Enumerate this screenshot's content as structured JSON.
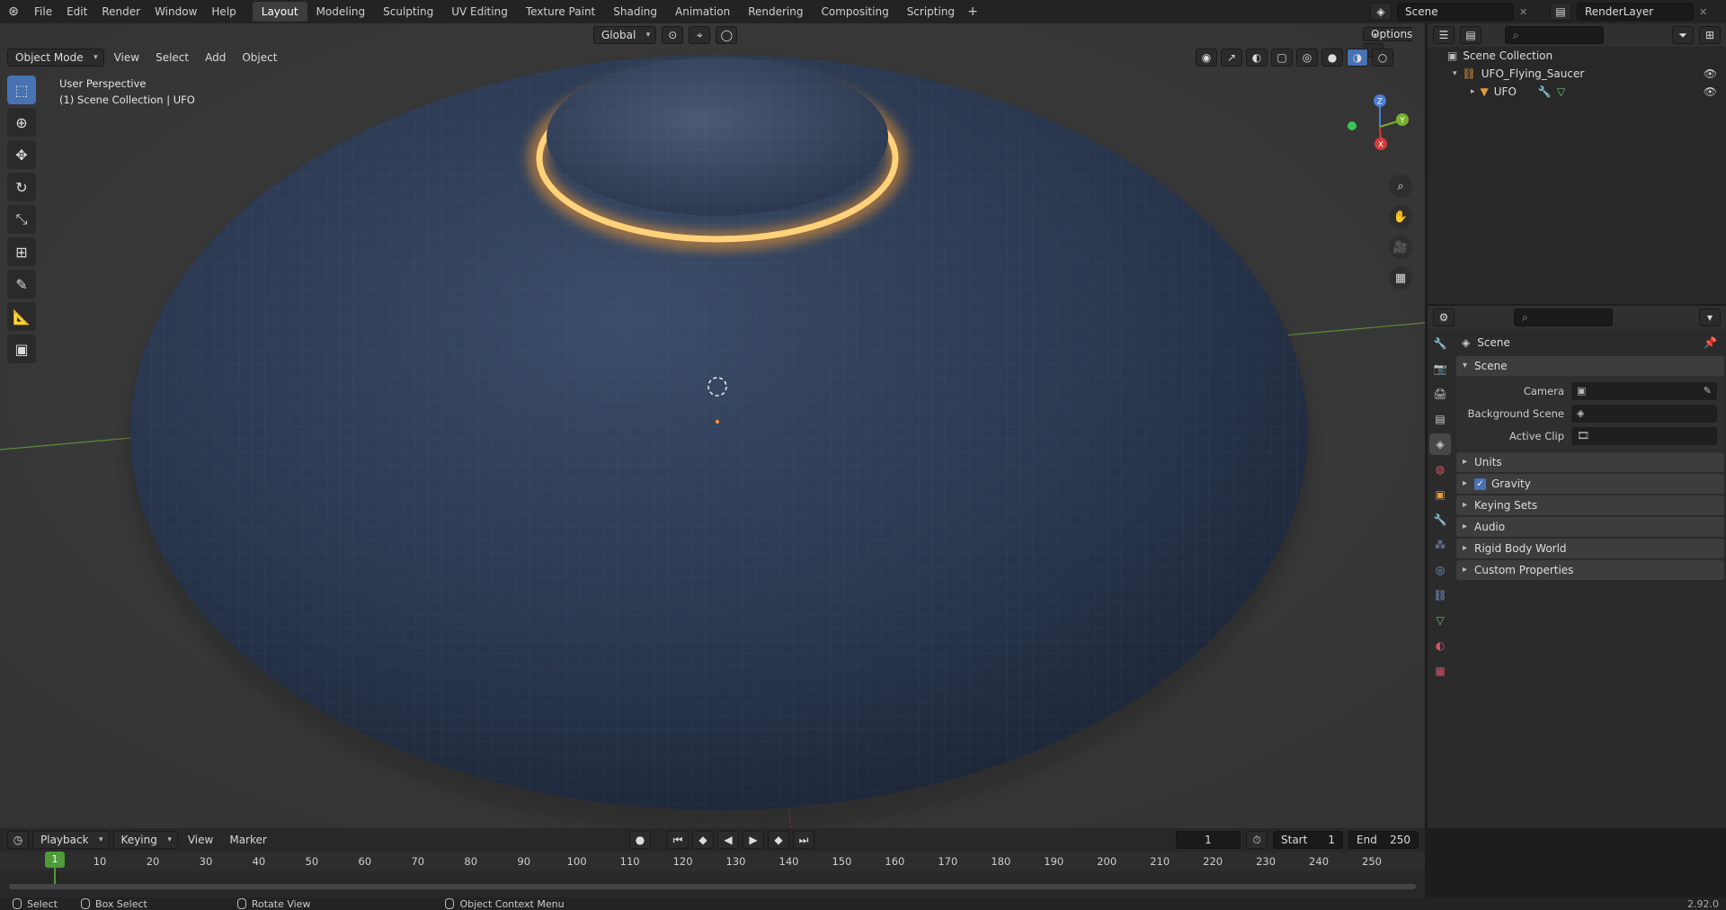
{
  "topbar": {
    "menus": [
      "File",
      "Edit",
      "Render",
      "Window",
      "Help"
    ],
    "workspaces": [
      "Layout",
      "Modeling",
      "Sculpting",
      "UV Editing",
      "Texture Paint",
      "Shading",
      "Animation",
      "Rendering",
      "Compositing",
      "Scripting"
    ],
    "active_workspace": "Layout",
    "add_tab": "+",
    "scene_name": "Scene",
    "view_layer": "RenderLayer"
  },
  "viewport": {
    "mode": "Object Mode",
    "menus": [
      "View",
      "Select",
      "Add",
      "Object"
    ],
    "transform_orientation": "Global",
    "options_label": "Options",
    "overlay_line1": "User Perspective",
    "overlay_line2": "(1) Scene Collection | UFO",
    "axis_x": "X",
    "axis_y": "Y",
    "axis_z": "Z"
  },
  "outliner": {
    "search_placeholder": "",
    "root": "Scene Collection",
    "collection": "UFO_Flying_Saucer",
    "object": "UFO"
  },
  "properties": {
    "context": "Scene",
    "panel_title": "Scene",
    "camera_label": "Camera",
    "background_scene_label": "Background Scene",
    "active_clip_label": "Active Clip",
    "sections": [
      "Units",
      "Gravity",
      "Keying Sets",
      "Audio",
      "Rigid Body World",
      "Custom Properties"
    ],
    "gravity_checked": true
  },
  "timeline": {
    "menus": [
      "Playback",
      "Keying",
      "View",
      "Marker"
    ],
    "current_frame": "1",
    "start_label": "Start",
    "start_value": "1",
    "end_label": "End",
    "end_value": "250",
    "ruler": [
      "1",
      "10",
      "20",
      "30",
      "40",
      "50",
      "60",
      "70",
      "80",
      "90",
      "100",
      "110",
      "120",
      "130",
      "140",
      "150",
      "160",
      "170",
      "180",
      "190",
      "200",
      "210",
      "220",
      "230",
      "240",
      "250"
    ]
  },
  "statusbar": {
    "select": "Select",
    "box_select": "Box Select",
    "rotate_view": "Rotate View",
    "context_menu": "Object Context Menu",
    "version": "2.92.0"
  },
  "colors": {
    "accent": "#4772b3",
    "playhead": "#4f9a3a",
    "saucer": "#2b3a52",
    "glow": "#ffb24a"
  }
}
